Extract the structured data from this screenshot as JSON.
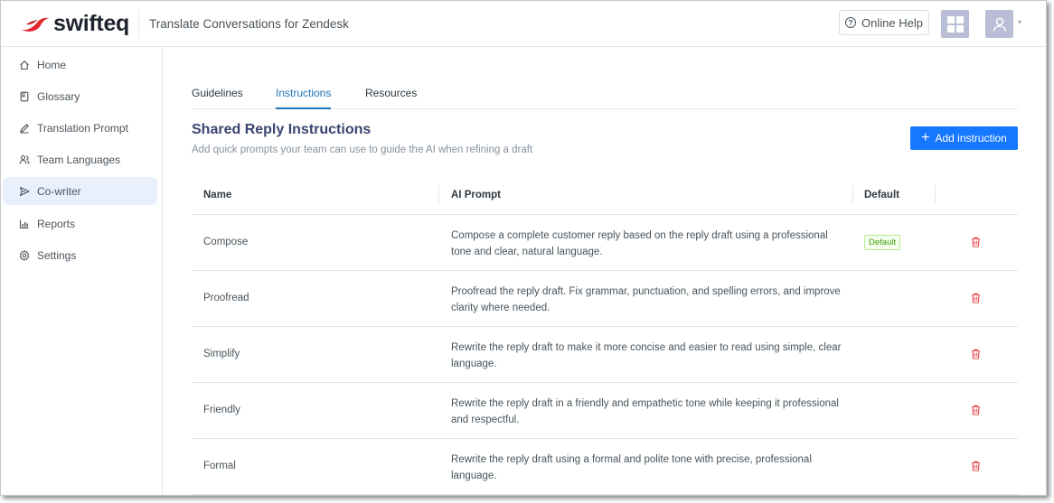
{
  "header": {
    "logo_text": "swifteq",
    "app_title": "Translate Conversations for Zendesk",
    "help_label": "Online Help"
  },
  "sidebar": {
    "items": [
      {
        "label": "Home",
        "icon": "home-icon",
        "active": false
      },
      {
        "label": "Glossary",
        "icon": "book-icon",
        "active": false
      },
      {
        "label": "Translation Prompt",
        "icon": "pen-icon",
        "active": false
      },
      {
        "label": "Team Languages",
        "icon": "team-icon",
        "active": false
      },
      {
        "label": "Co-writer",
        "icon": "send-icon",
        "active": true
      },
      {
        "label": "Reports",
        "icon": "bar-chart-icon",
        "active": false
      },
      {
        "label": "Settings",
        "icon": "gear-icon",
        "active": false
      }
    ]
  },
  "tabs": [
    {
      "label": "Guidelines",
      "active": false
    },
    {
      "label": "Instructions",
      "active": true
    },
    {
      "label": "Resources",
      "active": false
    }
  ],
  "section": {
    "title": "Shared Reply Instructions",
    "subtitle": "Add quick prompts your team can use to guide the AI when refining a draft",
    "add_button_label": "Add instruction"
  },
  "table": {
    "columns": [
      "Name",
      "AI Prompt",
      "Default"
    ],
    "rows": [
      {
        "name": "Compose",
        "prompt": "Compose a complete customer reply based on the reply draft using a professional tone and clear, natural language.",
        "default": "Default"
      },
      {
        "name": "Proofread",
        "prompt": "Proofread the reply draft. Fix grammar, punctuation, and spelling errors, and improve clarity where needed.",
        "default": ""
      },
      {
        "name": "Simplify",
        "prompt": "Rewrite the reply draft to make it more concise and easier to read using simple, clear language.",
        "default": ""
      },
      {
        "name": "Friendly",
        "prompt": "Rewrite the reply draft in a friendly and empathetic tone while keeping it professional and respectful.",
        "default": ""
      },
      {
        "name": "Formal",
        "prompt": "Rewrite the reply draft using a formal and polite tone with precise, professional language.",
        "default": ""
      }
    ]
  },
  "colors": {
    "accent": "#1677ff",
    "tab_active": "#1f73b7",
    "title": "#3a4470",
    "delete": "#e5484d",
    "badge_green": "#389e0d",
    "brand_red": "#e3262e"
  }
}
